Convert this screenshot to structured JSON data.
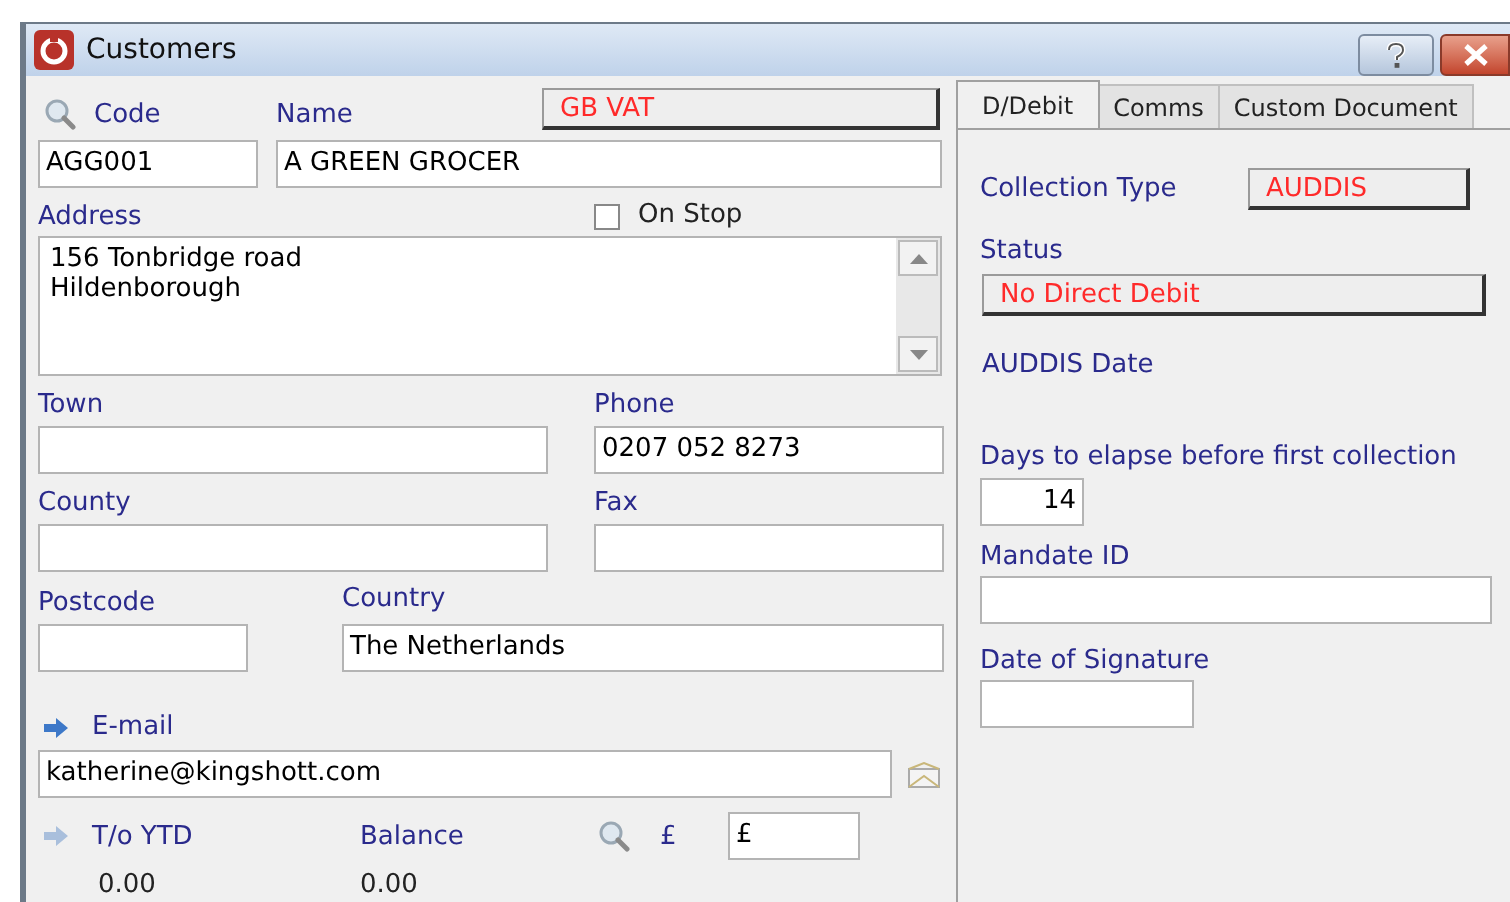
{
  "window": {
    "title": "Customers"
  },
  "form": {
    "code_label": "Code",
    "name_label": "Name",
    "vat_button": "GB VAT",
    "code_value": "AGG001",
    "name_value": "A GREEN GROCER",
    "address_label": "Address",
    "on_stop": {
      "label": "On Stop",
      "checked": false
    },
    "address_lines": [
      "156 Tonbridge road",
      "Hildenborough"
    ],
    "town_label": "Town",
    "phone_label": "Phone",
    "phone_value": "0207 052 8273",
    "county_label": "County",
    "fax_label": "Fax",
    "postcode_label": "Postcode",
    "country_label": "Country",
    "country_value": "The Netherlands",
    "email_label": "E-mail",
    "email_value": "katherine@kingshott.com",
    "turnover": {
      "label": "T/o YTD",
      "value": "0.00"
    },
    "balance": {
      "label": "Balance",
      "value": "0.00"
    },
    "currency_label": "£",
    "currency_value": "£"
  },
  "tabs": [
    {
      "label": "D/Debit",
      "selected": true
    },
    {
      "label": "Comms",
      "selected": false
    },
    {
      "label": "Custom Document",
      "selected": false
    }
  ],
  "direct_debit": {
    "collection_type_label": "Collection Type",
    "collection_type_value": "AUDDIS",
    "status_label": "Status",
    "status_value": "No Direct Debit",
    "auddis_date_label": "AUDDIS Date",
    "days_label": "Days to elapse before first collection",
    "days_value": "14",
    "mandate_label": "Mandate ID",
    "signature_label": "Date of Signature"
  }
}
